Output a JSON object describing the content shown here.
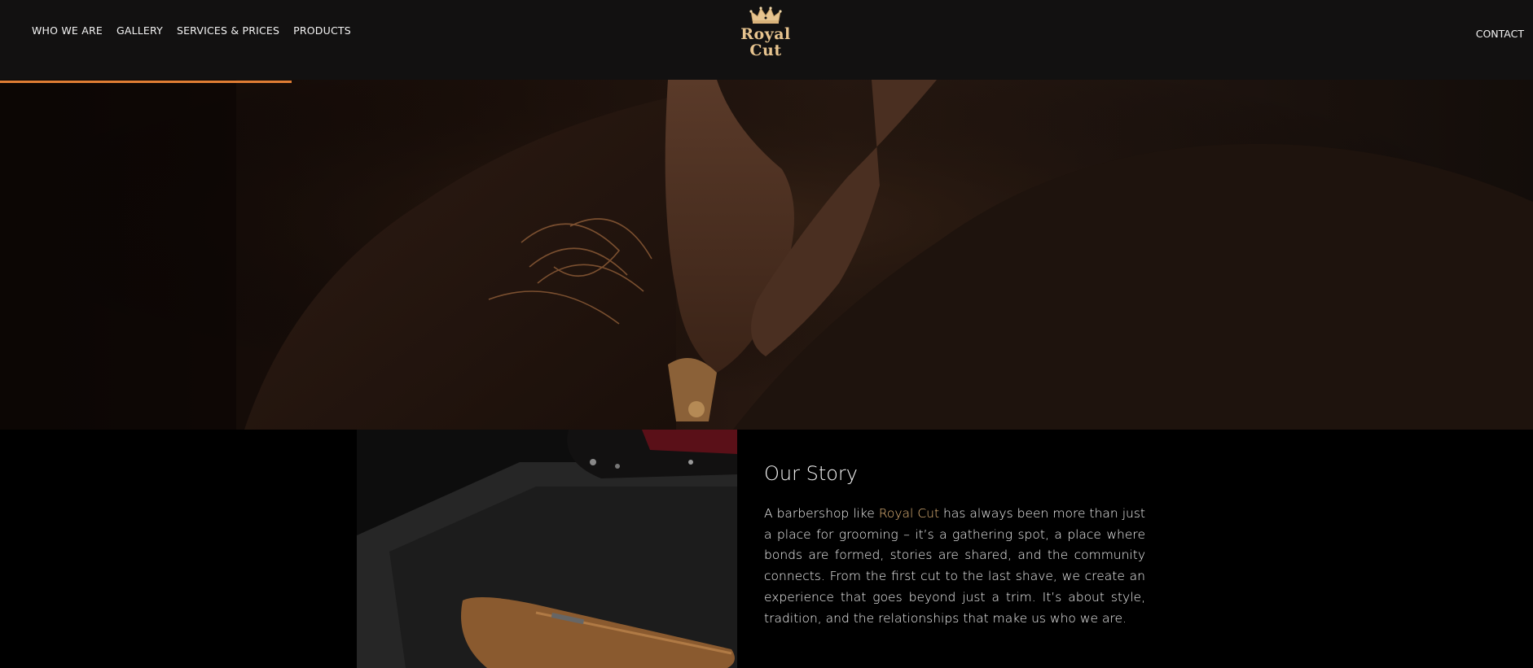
{
  "header": {
    "nav": [
      {
        "label": "WHO WE ARE"
      },
      {
        "label": "GALLERY"
      },
      {
        "label": "SERVICES & PRICES"
      },
      {
        "label": "PRODUCTS"
      }
    ],
    "logo_text": "Royal Cut",
    "contact_label": "CONTACT",
    "scroll_progress": 0.19
  },
  "story": {
    "title": "Our Story",
    "para_before": "A barbershop like ",
    "brand": "Royal Cut",
    "para_after": " has always been more than just a place for grooming – it’s a gathering spot, a place where bonds are formed, stories are shared, and the community connects. From the first cut to the last shave, we create an experience that goes beyond just a trim. It’s about style, tradition, and the relationships that make us who we are."
  },
  "colors": {
    "accent": "#e07d34",
    "brand_text": "#e6b77a",
    "header_bg": "#121111"
  },
  "icons": {
    "logo": "crown-icon"
  }
}
